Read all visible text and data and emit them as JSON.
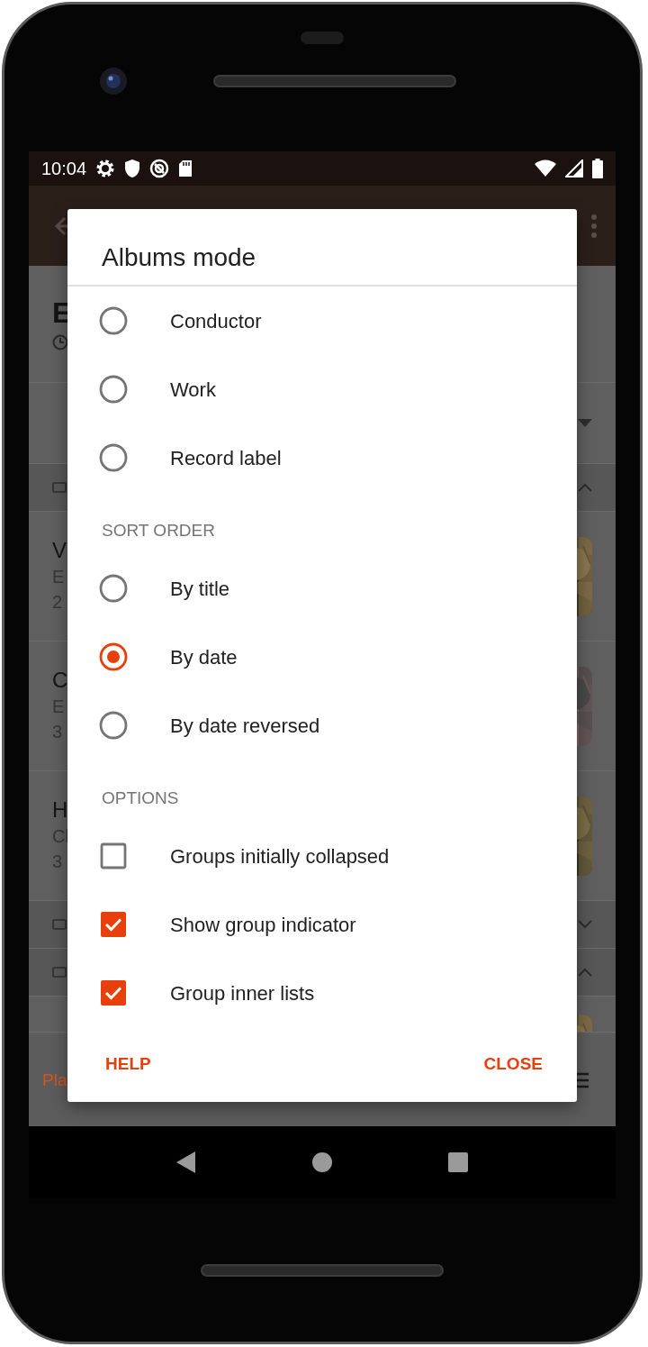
{
  "status_bar": {
    "time": "10:04"
  },
  "background": {
    "rows": [
      {
        "kind": "title",
        "title": "E"
      },
      {
        "kind": "dropdown"
      },
      {
        "kind": "group",
        "expanded": true
      },
      {
        "kind": "item",
        "title": "V",
        "subtitle": "E",
        "detail": "2"
      },
      {
        "kind": "item",
        "title": "C",
        "subtitle": "E",
        "detail": "3"
      },
      {
        "kind": "item",
        "title": "H",
        "subtitle": "Cl",
        "detail": "3"
      },
      {
        "kind": "group",
        "expanded": false
      },
      {
        "kind": "group",
        "expanded": true
      },
      {
        "kind": "peek"
      }
    ],
    "bottom_bar": {
      "action": "Pla"
    }
  },
  "dialog": {
    "title": "Albums mode",
    "sections": [
      {
        "items": [
          {
            "kind": "radio",
            "label": "Conductor",
            "selected": false
          },
          {
            "kind": "radio",
            "label": "Work",
            "selected": false
          },
          {
            "kind": "radio",
            "label": "Record label",
            "selected": false
          }
        ]
      },
      {
        "header": "SORT ORDER",
        "items": [
          {
            "kind": "radio",
            "label": "By title",
            "selected": false
          },
          {
            "kind": "radio",
            "label": "By date",
            "selected": true
          },
          {
            "kind": "radio",
            "label": "By date reversed",
            "selected": false
          }
        ]
      },
      {
        "header": "OPTIONS",
        "items": [
          {
            "kind": "checkbox",
            "label": "Groups initially collapsed",
            "checked": false
          },
          {
            "kind": "checkbox",
            "label": "Show group indicator",
            "checked": true
          },
          {
            "kind": "checkbox",
            "label": "Group inner lists",
            "checked": true
          }
        ]
      }
    ],
    "buttons": [
      {
        "label": "HELP"
      },
      {
        "label": "CLOSE"
      }
    ]
  }
}
